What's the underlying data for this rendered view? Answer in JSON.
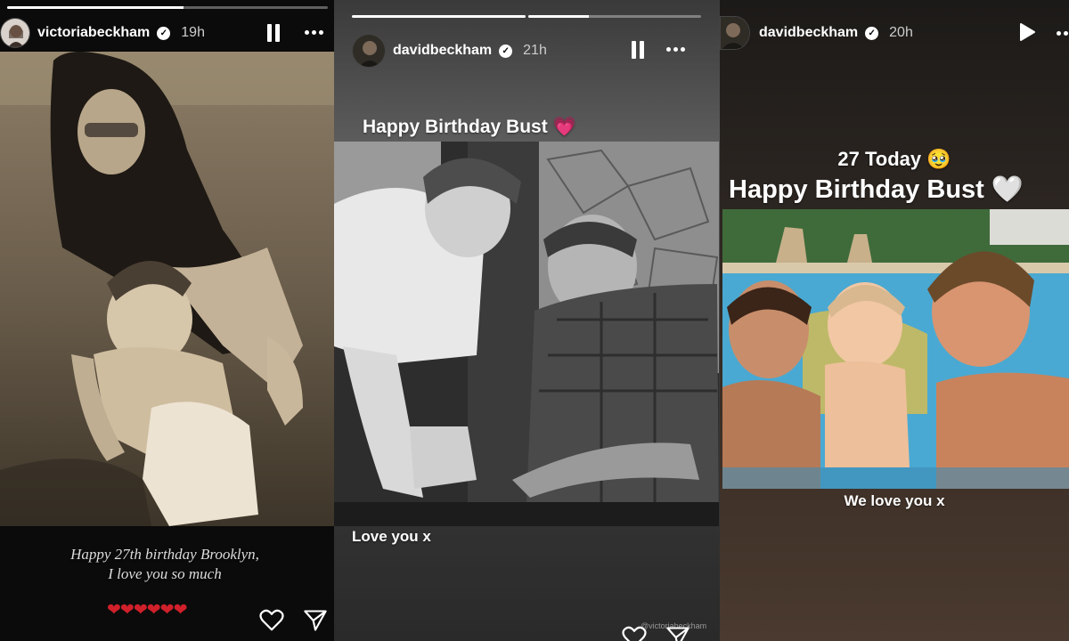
{
  "stories": [
    {
      "username": "victoriabeckham",
      "time": "19h",
      "caption_line1": "Happy 27th birthday Brooklyn,",
      "caption_line2": "I love you so much",
      "hearts": "❤❤❤❤❤❤",
      "progress": 0.55,
      "control": "pause-icon"
    },
    {
      "username": "davidbeckham",
      "time": "21h",
      "headline": "Happy Birthday Bust",
      "headline_emoji": "💗",
      "caption": "Love you x",
      "tag": "@victoriabeckham",
      "progress_segments": [
        1.0,
        0.35
      ],
      "control": "pause-icon"
    },
    {
      "username": "davidbeckham",
      "time": "20h",
      "headline_line1": "27 Today 🥹",
      "headline_line2": "Happy Birthday Bust 🤍",
      "caption": "We love you x",
      "control": "play-icon"
    }
  ],
  "colors": {
    "heart": "#d0202a",
    "pink_heart": "#ff3fa4",
    "white": "#ffffff"
  }
}
